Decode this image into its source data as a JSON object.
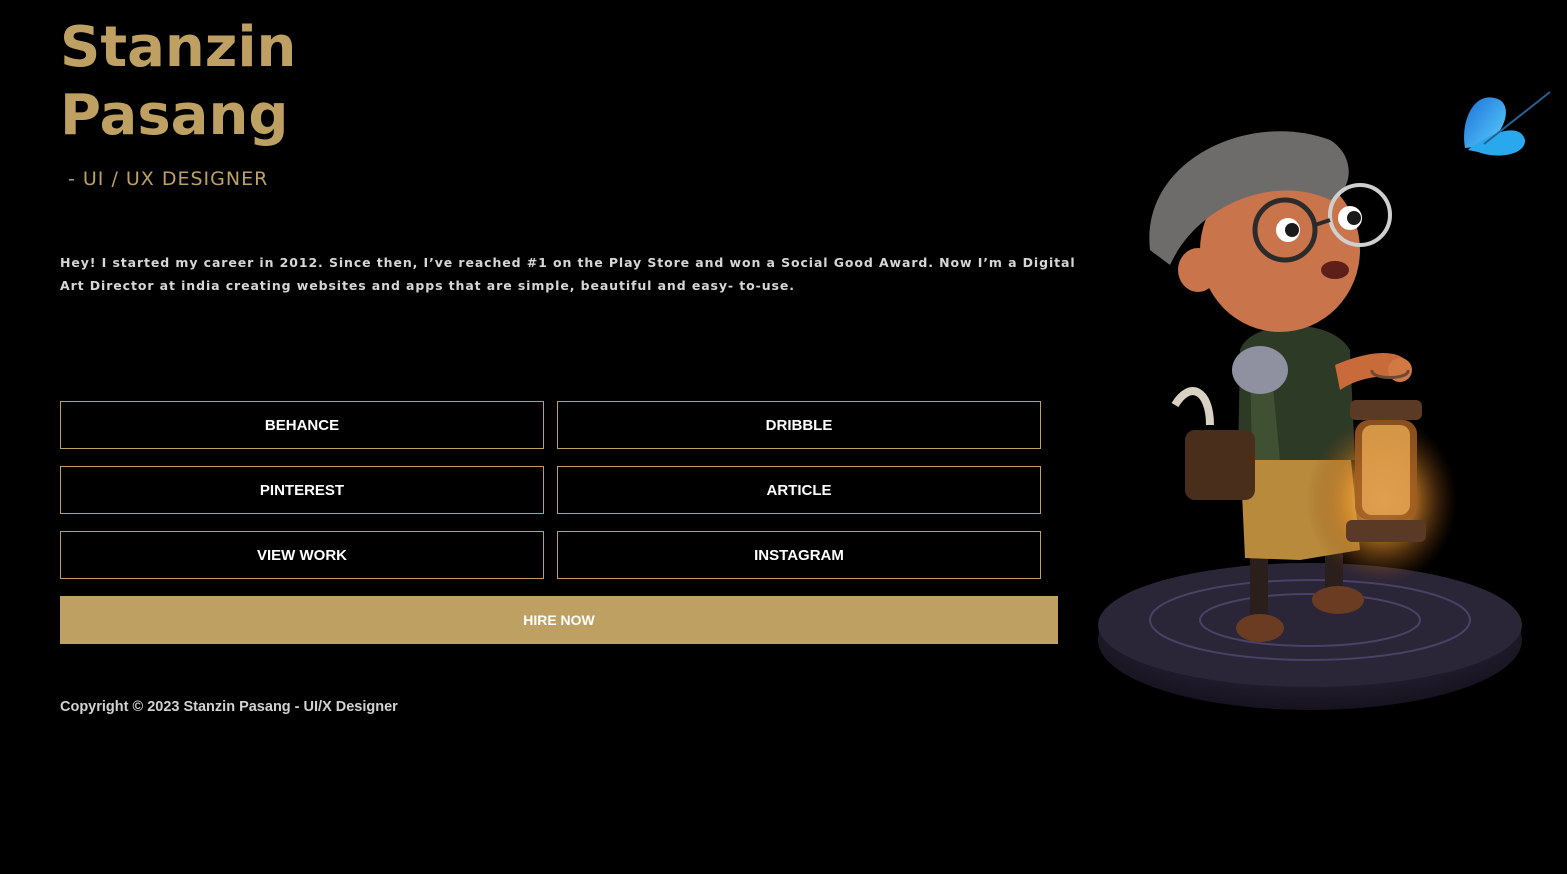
{
  "header": {
    "first_name": "Stanzin",
    "last_name": "Pasang",
    "role": "- UI / UX DESIGNER"
  },
  "bio": "Hey! I started my career in 2012. Since then, I’ve reached #1 on the Play Store and won a Social Good Award. Now I’m a Digital Art Director at india creating websites and apps that are simple, beautiful and easy- to-use.",
  "links": {
    "behance": "BEHANCE",
    "dribble": "DRIBBLE",
    "pinterest": "PINTEREST",
    "article": "ARTICLE",
    "view_work": "VIEW WORK",
    "instagram": "INSTAGRAM"
  },
  "cta": {
    "hire_label": "HIRE NOW"
  },
  "footer": {
    "copyright": "Copyright © 2023 Stanzin Pasang - UI/X Designer"
  },
  "colors": {
    "background": "#000000",
    "accent": "#bea162",
    "text": "#ffffff"
  },
  "hero": {
    "icon": "boy-with-lantern-illustration"
  }
}
